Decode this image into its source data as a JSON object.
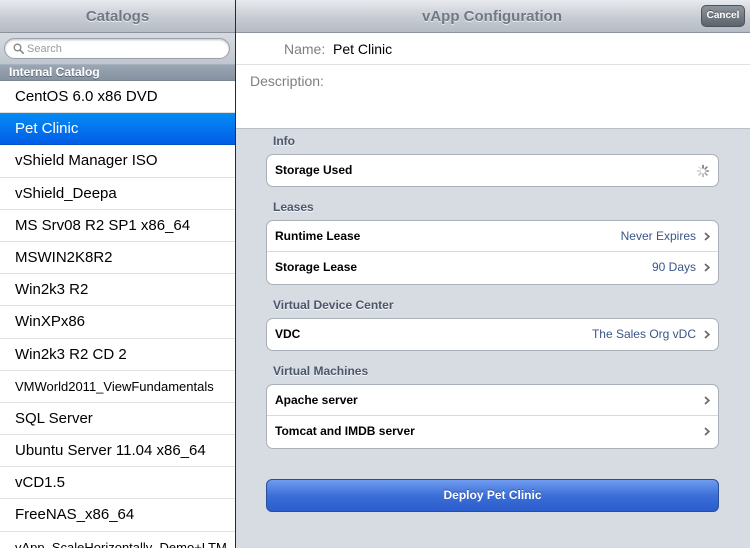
{
  "left": {
    "title": "Catalogs",
    "search": {
      "placeholder": "Search",
      "value": ""
    },
    "section_header": "Internal Catalog",
    "items": [
      {
        "label": "CentOS 6.0 x86 DVD"
      },
      {
        "label": "Pet Clinic",
        "selected": true
      },
      {
        "label": "vShield Manager ISO"
      },
      {
        "label": "vShield_Deepa"
      },
      {
        "label": "MS Srv08 R2 SP1 x86_64"
      },
      {
        "label": "MSWIN2K8R2"
      },
      {
        "label": "Win2k3 R2"
      },
      {
        "label": "WinXPx86"
      },
      {
        "label": "Win2k3 R2 CD 2"
      },
      {
        "label": "VMWorld2011_ViewFundamentals"
      },
      {
        "label": "SQL Server"
      },
      {
        "label": "Ubuntu Server 11.04 x86_64"
      },
      {
        "label": "vCD1.5"
      },
      {
        "label": "FreeNAS_x86_64"
      },
      {
        "label": "vApp_ScaleHorizontally_Demo+LTM"
      }
    ]
  },
  "right": {
    "title": "vApp Configuration",
    "cancel_label": "Cancel",
    "name_label": "Name:",
    "name_value": "Pet Clinic",
    "description_label": "Description:",
    "groups": {
      "info": {
        "header": "Info",
        "rows": [
          {
            "label": "Storage Used"
          }
        ]
      },
      "leases": {
        "header": "Leases",
        "rows": [
          {
            "label": "Runtime Lease",
            "value": "Never Expires"
          },
          {
            "label": "Storage Lease",
            "value": "90 Days"
          }
        ]
      },
      "vdc": {
        "header": "Virtual Device Center",
        "rows": [
          {
            "label": "VDC",
            "value": "The Sales Org vDC"
          }
        ]
      },
      "vms": {
        "header": "Virtual Machines",
        "rows": [
          {
            "label": "Apache server"
          },
          {
            "label": "Tomcat and IMDB server"
          }
        ]
      }
    },
    "deploy_label": "Deploy Pet Clinic"
  },
  "colors": {
    "selection_blue": "#0475ee",
    "group_header_text": "#4c566c",
    "detail_value_text": "#3a5589",
    "deploy_button": "#3c6fd8"
  },
  "icons": [
    "search-icon",
    "chevron-right-icon",
    "activity-spinner-icon"
  ]
}
